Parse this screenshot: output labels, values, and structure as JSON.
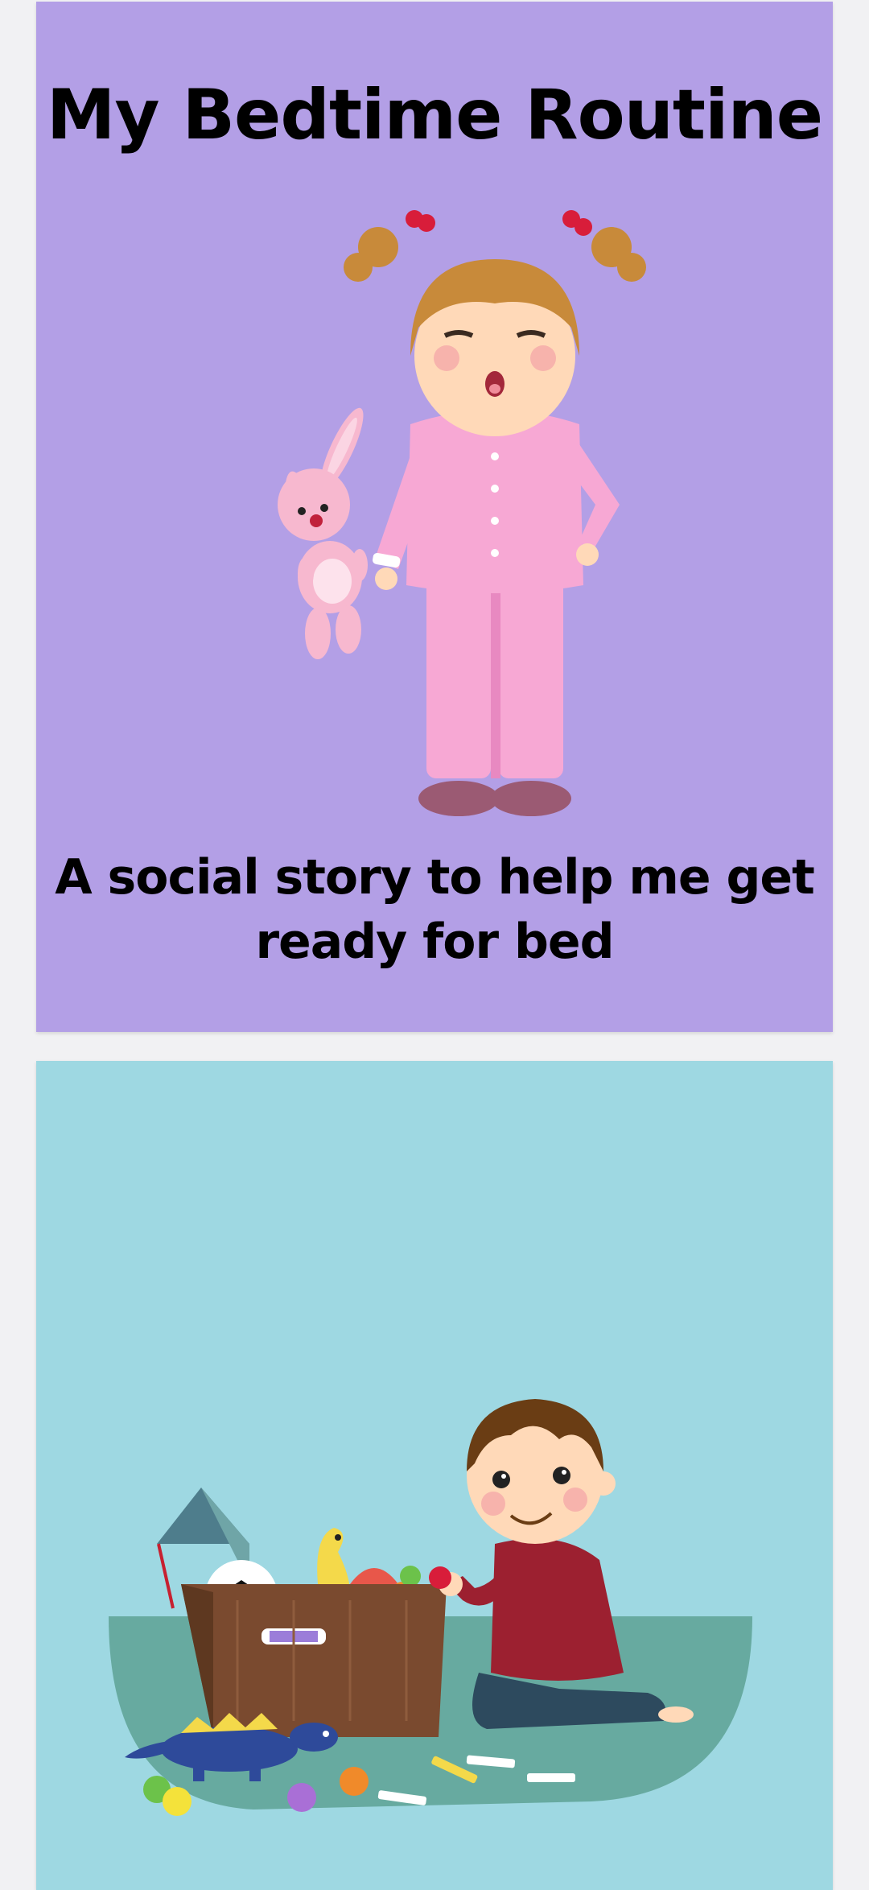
{
  "pages": [
    {
      "title": "My Bedtime Routine",
      "subtitle": "A social story to help me get ready for bed",
      "background": "#b39fe6",
      "illustration": "sleepy-girl-in-pajamas-with-bunny"
    },
    {
      "background": "#9ed8e2",
      "illustration": "boy-putting-toys-in-box"
    }
  ]
}
